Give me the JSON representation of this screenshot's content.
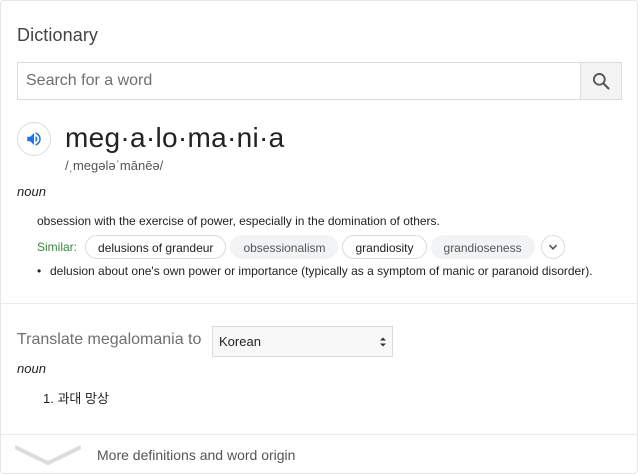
{
  "header": {
    "title": "Dictionary"
  },
  "search": {
    "placeholder": "Search for a word",
    "value": ""
  },
  "entry": {
    "headword": "meg·a·lo·ma·ni·a",
    "phonetic": "/ˌmeɡələˈmānēə/",
    "part_of_speech": "noun",
    "definition_1": "obsession with the exercise of power, especially in the domination of others.",
    "similar_label": "Similar:",
    "similar": [
      {
        "label": "delusions of grandeur",
        "emphasis": "outline"
      },
      {
        "label": "obsessionalism",
        "emphasis": "filled"
      },
      {
        "label": "grandiosity",
        "emphasis": "outline"
      },
      {
        "label": "grandioseness",
        "emphasis": "filled"
      }
    ],
    "definition_2": "delusion about one's own power or importance (typically as a symptom of manic or paranoid disorder)."
  },
  "translate": {
    "label": "Translate megalomania to",
    "language": "Korean",
    "part_of_speech": "noun",
    "number": "1.",
    "result": "과대 망상"
  },
  "footer": {
    "more_label": "More definitions and word origin"
  },
  "colors": {
    "accent_blue": "#1a73e8",
    "similar_green": "#39873b"
  }
}
